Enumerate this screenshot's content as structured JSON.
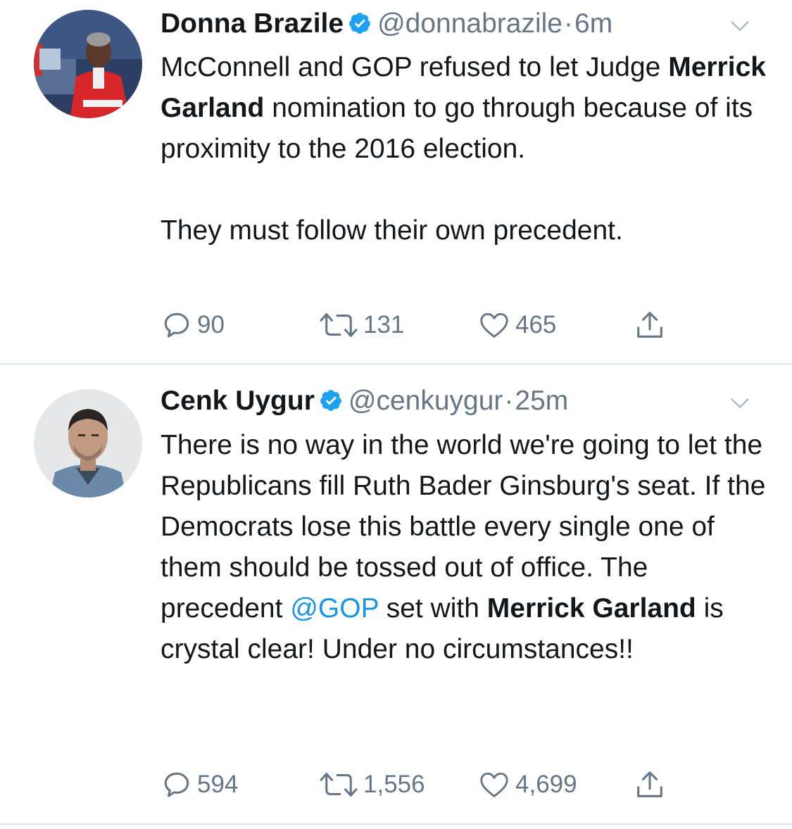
{
  "tweets": [
    {
      "name": "Donna Brazile",
      "handle": "@donnabrazile",
      "separator": "·",
      "time": "6m",
      "text": {
        "p1_a": "McConnell and GOP refused to let Judge ",
        "p1_bold": "Merrick Garland",
        "p1_b": " nomination to go through because of its proximity to the 2016 election.",
        "p2": "They must follow their own precedent."
      },
      "stats": {
        "replies": "90",
        "retweets": "131",
        "likes": "465"
      }
    },
    {
      "name": "Cenk Uygur",
      "handle": "@cenkuygur",
      "separator": "·",
      "time": "25m",
      "text": {
        "a": "There is no way in the world we're going to let the Republicans fill Ruth Bader Ginsburg's seat. If the Democrats lose this battle every single one of them should be tossed out of office. The precedent ",
        "mention": "@GOP",
        "b": " set with ",
        "bold1": "Merrick",
        "c": " ",
        "bold2": "Garland",
        "d": " is crystal clear! Under no circumstances!!"
      },
      "stats": {
        "replies": "594",
        "retweets": "1,556",
        "likes": "4,699"
      }
    }
  ],
  "icons": {
    "verified": "verified-badge-icon",
    "caret": "chevron-down-icon",
    "reply": "reply-icon",
    "retweet": "retweet-icon",
    "like": "heart-icon",
    "share": "share-icon"
  },
  "colors": {
    "verified": "#1da1f2",
    "link": "#1b95e0",
    "muted": "#657786",
    "divider": "#e1e8ed"
  }
}
